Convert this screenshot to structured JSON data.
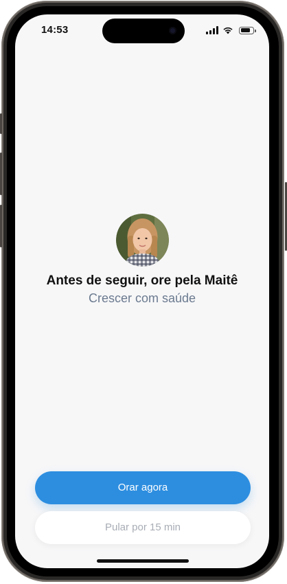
{
  "status_bar": {
    "time": "14:53",
    "icons": [
      "signal-icon",
      "wifi-icon",
      "battery-icon"
    ],
    "battery_level": 0.85
  },
  "prompt": {
    "avatar_icon": "child-photo",
    "title": "Antes de seguir, ore pela Maitê",
    "subtitle": "Crescer com saúde"
  },
  "actions": {
    "primary_label": "Orar agora",
    "secondary_label": "Pular por 15 min"
  },
  "colors": {
    "primary": "#2d8ee0",
    "subtitle": "#6b7a8f",
    "background": "#f7f7f8",
    "secondary_text": "#a8adb5"
  }
}
